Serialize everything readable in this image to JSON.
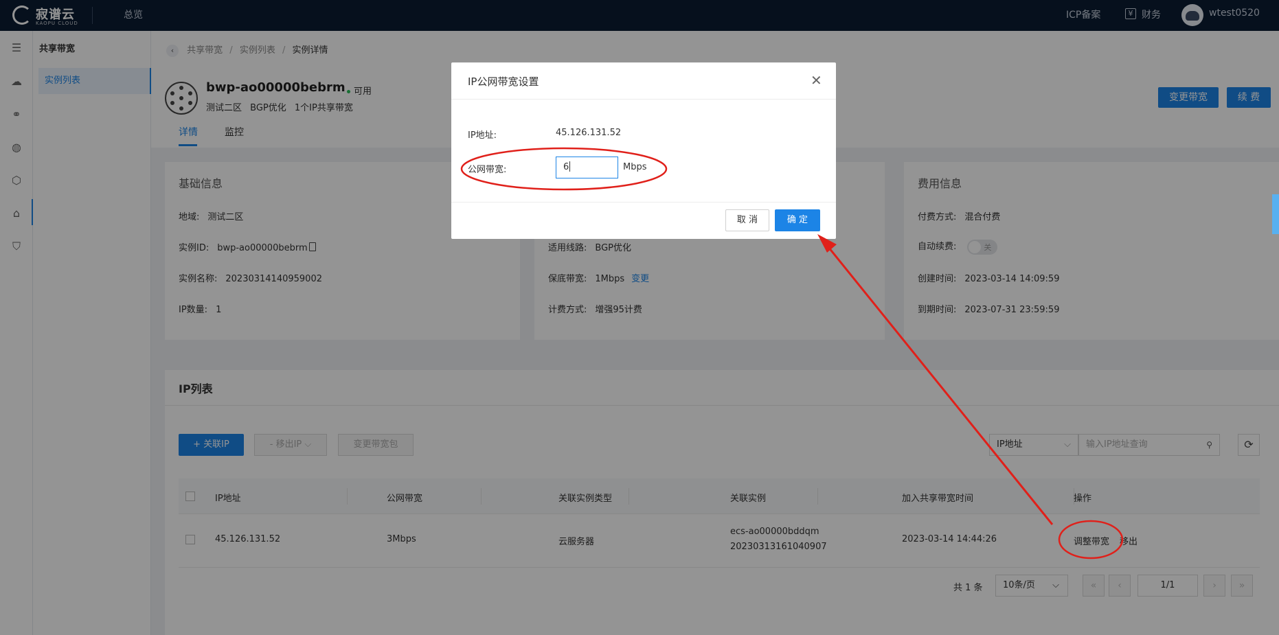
{
  "topbar": {
    "logo_text": "寂谱云",
    "logo_sub": "KAOPU CLOUD",
    "nav_overview": "总览",
    "icp": "ICP备案",
    "finance": "财务",
    "username": "wtest0520"
  },
  "subnav": {
    "title": "共享带宽",
    "item": "实例列表"
  },
  "breadcrumb": [
    "共享带宽",
    "实例列表",
    "实例详情"
  ],
  "instance": {
    "name": "bwp-ao00000bebrm",
    "status": "可用",
    "zone": "测试二区",
    "line": "BGP优化",
    "ip_desc": "1个IP共享带宽"
  },
  "tabs": {
    "detail": "详情",
    "monitor": "监控"
  },
  "actions": {
    "change_bw": "变更带宽",
    "renew": "续 费"
  },
  "basic_info": {
    "title": "基础信息",
    "region_label": "地域:",
    "region": "测试二区",
    "id_label": "实例ID:",
    "id": "bwp-ao00000bebrm",
    "name_label": "实例名称:",
    "name": "20230314140959002",
    "ip_count_label": "IP数量:",
    "ip_count": "1"
  },
  "bw_info": {
    "line_label": "适用线路:",
    "line": "BGP优化",
    "min_bw_label": "保底带宽:",
    "min_bw": "1Mbps",
    "change": "变更",
    "billing_label": "计费方式:",
    "billing": "增强95计费"
  },
  "fee_info": {
    "title": "费用信息",
    "pay_label": "付费方式:",
    "pay": "混合付费",
    "auto_renew_label": "自动续费:",
    "auto_renew": "关",
    "created_label": "创建时间:",
    "created": "2023-03-14 14:09:59",
    "expire_label": "到期时间:",
    "expire": "2023-07-31 23:59:59"
  },
  "ip_list": {
    "title": "IP列表",
    "add_ip": "+ 关联IP",
    "remove_ip": "- 移出IP",
    "change_pkg": "变更带宽包",
    "filter_select": "IP地址",
    "search_placeholder": "输入IP地址查询",
    "columns": [
      "IP地址",
      "公网带宽",
      "关联实例类型",
      "关联实例",
      "加入共享带宽时间",
      "操作"
    ],
    "rows": [
      {
        "ip": "45.126.131.52",
        "bandwidth": "3Mbps",
        "type": "云服务器",
        "instance_id": "ecs-ao00000bddqm",
        "instance_name": "20230313161040907",
        "joined": "2023-03-14 14:44:26",
        "op_adjust": "调整带宽",
        "op_remove": "移出"
      }
    ],
    "total": "共 1 条",
    "page_size": "10条/页",
    "page": "1/1"
  },
  "modal": {
    "title": "IP公网带宽设置",
    "ip_label": "IP地址:",
    "ip": "45.126.131.52",
    "bw_label": "公网带宽:",
    "bw_value": "6",
    "unit": "Mbps",
    "cancel": "取 消",
    "ok": "确 定"
  },
  "colors": {
    "accent": "#1c84e6",
    "annotation": "#e0201a",
    "topbar": "#0b1c33"
  }
}
